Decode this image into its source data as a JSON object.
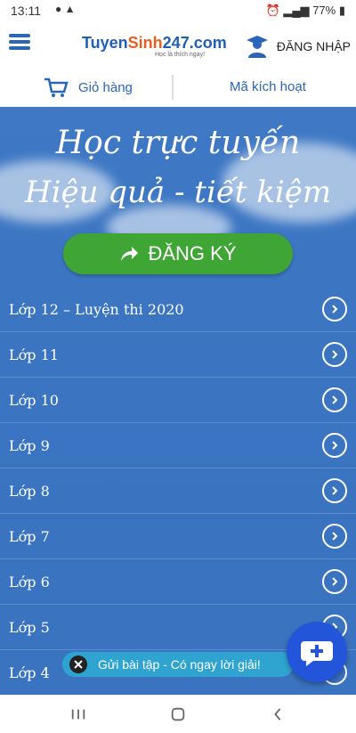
{
  "status": {
    "time": "13:11",
    "battery": "77%"
  },
  "header": {
    "brand_a": "Tuyen",
    "brand_b": "Sinh",
    "brand_c": "247",
    "brand_d": ".com",
    "slogan": "Học là thích ngay!",
    "login_label": "ĐĂNG NHẬP"
  },
  "subnav": {
    "cart_label": "Giỏ hàng",
    "activate_label": "Mã kích hoạt"
  },
  "hero": {
    "line1": "Học trực tuyến",
    "line2": "Hiệu quả - tiết kiệm",
    "register_label": "ĐĂNG KÝ"
  },
  "grades": [
    "Lớp 12 – Luyện thi 2020",
    "Lớp 11",
    "Lớp 10",
    "Lớp 9",
    "Lớp 8",
    "Lớp 7",
    "Lớp 6",
    "Lớp 5",
    "Lớp 4"
  ],
  "toast": {
    "text": "Gửi bài tập - Có ngay lời giải!"
  },
  "colors": {
    "primary": "#2a66b7",
    "green": "#3fa535",
    "toast": "#2fa4d0",
    "fab": "#2255d9"
  }
}
